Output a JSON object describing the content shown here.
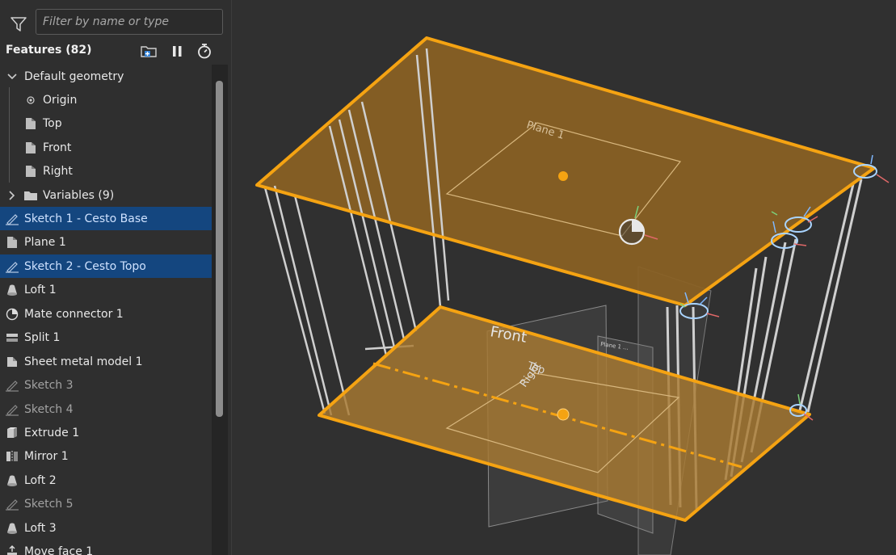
{
  "filter": {
    "placeholder": "Filter by name or type"
  },
  "features": {
    "title": "Features (82)",
    "items": [
      {
        "label": "Default geometry",
        "icon": "chevron-down-icon"
      },
      {
        "label": "Origin",
        "icon": "origin-icon"
      },
      {
        "label": "Top",
        "icon": "plane-icon"
      },
      {
        "label": "Front",
        "icon": "plane-icon"
      },
      {
        "label": "Right",
        "icon": "plane-icon"
      },
      {
        "label": "Variables (9)",
        "icon": "folder-icon"
      },
      {
        "label": "Sketch 1 - Cesto Base",
        "icon": "sketch-icon",
        "selected": true
      },
      {
        "label": "Plane 1",
        "icon": "plane-icon"
      },
      {
        "label": "Sketch 2 - Cesto Topo",
        "icon": "sketch-icon",
        "selected": true
      },
      {
        "label": "Loft 1",
        "icon": "loft-icon"
      },
      {
        "label": "Mate connector 1",
        "icon": "mate-connector-icon"
      },
      {
        "label": "Split 1",
        "icon": "split-icon"
      },
      {
        "label": "Sheet metal model 1",
        "icon": "sheet-metal-icon"
      },
      {
        "label": "Sketch 3",
        "icon": "sketch-icon",
        "dimmed": true
      },
      {
        "label": "Sketch 4",
        "icon": "sketch-icon",
        "dimmed": true
      },
      {
        "label": "Extrude 1",
        "icon": "extrude-icon"
      },
      {
        "label": "Mirror 1",
        "icon": "mirror-icon"
      },
      {
        "label": "Loft 2",
        "icon": "loft-icon"
      },
      {
        "label": "Sketch 5",
        "icon": "sketch-icon",
        "dimmed": true
      },
      {
        "label": "Loft 3",
        "icon": "loft-icon"
      },
      {
        "label": "Move face 1",
        "icon": "move-face-icon"
      }
    ]
  },
  "viewport": {
    "labels": {
      "plane1": "Plane 1",
      "front": "Front",
      "top": "Top",
      "right": "Right",
      "plane_small": "Plane 1 ..."
    }
  },
  "colors": {
    "accent": "#f5a312",
    "selection": "#14467f",
    "background": "#303030"
  }
}
